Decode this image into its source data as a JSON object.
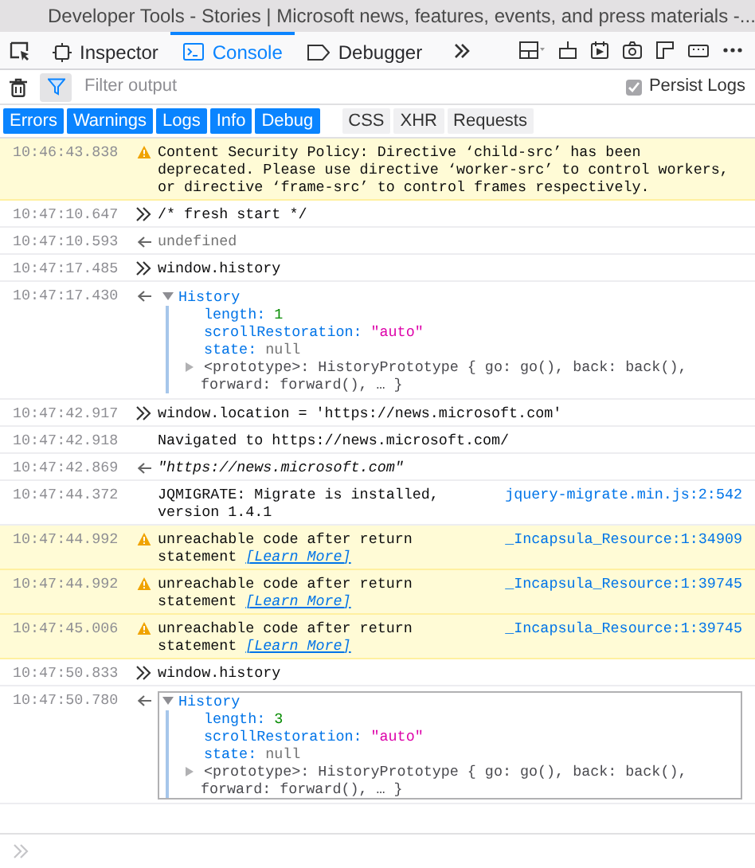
{
  "window": {
    "title": "Developer Tools - Stories | Microsoft news, features, events, and press materials -..."
  },
  "tabs": [
    {
      "label": "Inspector",
      "selected": false
    },
    {
      "label": "Console",
      "selected": true
    },
    {
      "label": "Debugger",
      "selected": false
    }
  ],
  "filter": {
    "placeholder": "Filter output",
    "persist_logs": {
      "label": "Persist Logs",
      "checked": true
    }
  },
  "filter_buttons": [
    {
      "label": "Errors",
      "selected": true
    },
    {
      "label": "Warnings",
      "selected": true
    },
    {
      "label": "Logs",
      "selected": true
    },
    {
      "label": "Info",
      "selected": true
    },
    {
      "label": "Debug",
      "selected": true
    },
    {
      "label": "CSS",
      "selected": false
    },
    {
      "label": "XHR",
      "selected": false
    },
    {
      "label": "Requests",
      "selected": false
    }
  ],
  "messages": [
    {
      "kind": "warning",
      "time": "10:46:43.838",
      "text": "Content Security Policy: Directive ‘child-src’ has been deprecated. Please use directive ‘worker-src’ to control workers, or directive ‘frame-src’ to control frames respectively."
    },
    {
      "kind": "input",
      "time": "10:47:10.647",
      "text": "/* fresh start */"
    },
    {
      "kind": "undefined_result",
      "time": "10:47:10.593",
      "text": "undefined"
    },
    {
      "kind": "input",
      "time": "10:47:17.485",
      "text": "window.history"
    },
    {
      "kind": "object",
      "time": "10:47:17.430",
      "name": "History",
      "expanded": true,
      "focused": false,
      "properties": [
        {
          "key": "length:",
          "value": "1",
          "kind": "number"
        },
        {
          "key": "scrollRestoration:",
          "value": "\"auto\"",
          "kind": "string"
        },
        {
          "key": "state:",
          "value": "null",
          "kind": "null"
        }
      ],
      "prototype": {
        "text": "<prototype>: HistoryPrototype { go: go(), back: back(), forward: forward(), … }",
        "expanded": false
      }
    },
    {
      "kind": "input",
      "time": "10:47:42.917",
      "text": "window.location = 'https://news.microsoft.com'"
    },
    {
      "kind": "log",
      "time": "10:47:42.918",
      "text": "Navigated to https://news.microsoft.com/"
    },
    {
      "kind": "string_result",
      "time": "10:47:42.869",
      "text": "\"https://news.microsoft.com\""
    },
    {
      "kind": "log",
      "time": "10:47:44.372",
      "text": "JQMIGRATE: Migrate is installed, version 1.4.1",
      "source": "jquery-migrate.min.js:2:542"
    },
    {
      "kind": "warning",
      "time": "10:47:44.992",
      "text": "unreachable code after return statement",
      "link": "[Learn More]",
      "source": "_Incapsula_Resource:1:34909"
    },
    {
      "kind": "warning",
      "time": "10:47:44.992",
      "text": "unreachable code after return statement",
      "link": "[Learn More]",
      "source": "_Incapsula_Resource:1:39745"
    },
    {
      "kind": "warning",
      "time": "10:47:45.006",
      "text": "unreachable code after return statement",
      "link": "[Learn More]",
      "source": "_Incapsula_Resource:1:39745"
    },
    {
      "kind": "input",
      "time": "10:47:50.833",
      "text": "window.history"
    },
    {
      "kind": "object",
      "time": "10:47:50.780",
      "name": "History",
      "expanded": true,
      "focused": true,
      "properties": [
        {
          "key": "length:",
          "value": "3",
          "kind": "number"
        },
        {
          "key": "scrollRestoration:",
          "value": "\"auto\"",
          "kind": "string"
        },
        {
          "key": "state:",
          "value": "null",
          "kind": "null"
        }
      ],
      "prototype": {
        "text": "<prototype>: HistoryPrototype { go: go(), back: back(), forward: forward(), … }",
        "expanded": false
      }
    }
  ]
}
